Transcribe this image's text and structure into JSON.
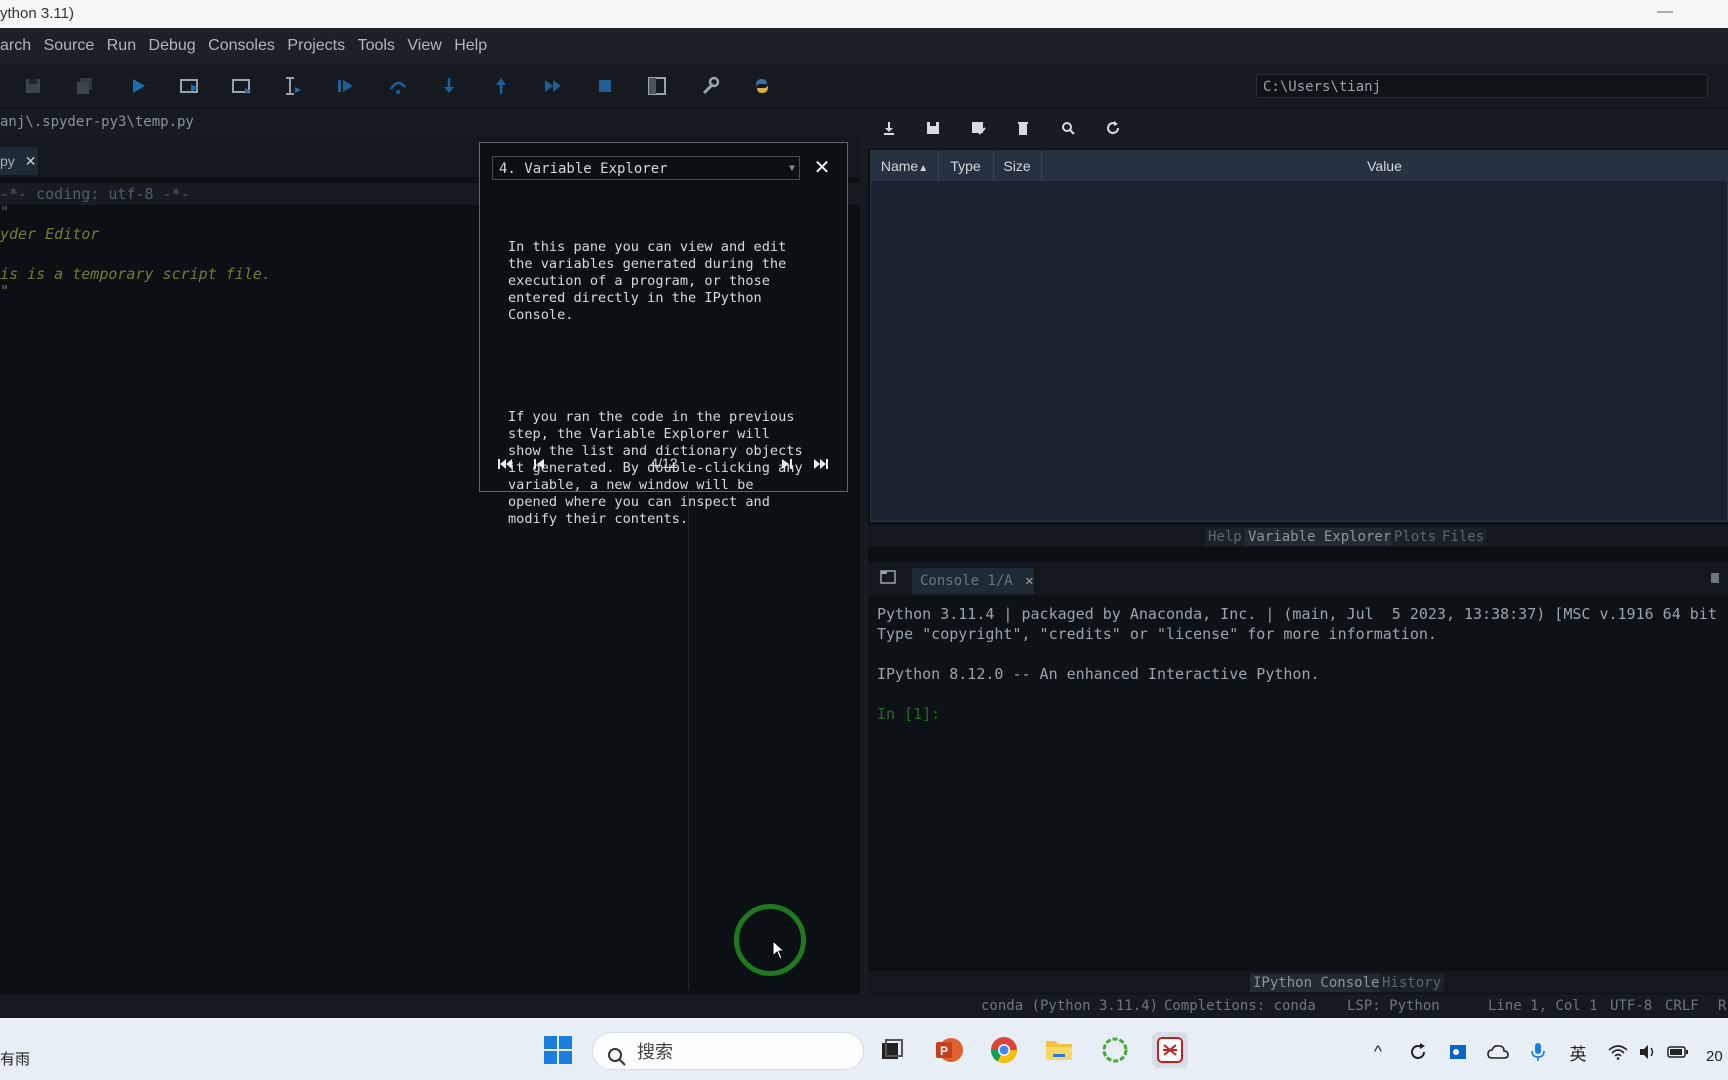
{
  "window": {
    "title": "ython 3.11)",
    "minimize": "—"
  },
  "menu": [
    "arch",
    "Source",
    "Run",
    "Debug",
    "Consoles",
    "Projects",
    "Tools",
    "View",
    "Help"
  ],
  "toolbar": {
    "working_dir": "C:\\Users\\tianj"
  },
  "editor": {
    "path": "anj\\.spyder-py3\\temp.py",
    "tab_label": "py",
    "lines": [
      "-*- coding: utf-8 -*-",
      "\"",
      "yder Editor",
      "",
      "is is a temporary script file.",
      "\""
    ]
  },
  "tour": {
    "selected": "4. Variable Explorer",
    "paragraph1": "In this pane you can view and edit\nthe variables generated during the\nexecution of a program, or those\nentered directly in the IPython\nConsole.",
    "paragraph2": "If you ran the code in the previous\nstep, the Variable Explorer will\nshow the list and dictionary objects\nit generated. By double-clicking any\nvariable, a new window will be\nopened where you can inspect and\nmodify their contents.",
    "step": "4/12"
  },
  "variable_explorer": {
    "columns": [
      "Name",
      "Type",
      "Size",
      "Value"
    ],
    "pane_tabs": [
      "Help",
      "Variable Explorer",
      "Plots",
      "Files"
    ],
    "active_tab": "Variable Explorer"
  },
  "console": {
    "tab_label": "Console 1/A",
    "lines": [
      "Python 3.11.4 | packaged by Anaconda, Inc. | (main, Jul  5 2023, 13:38:37) [MSC v.1916 64 bit (",
      "Type \"copyright\", \"credits\" or \"license\" for more information.",
      "",
      "IPython 8.12.0 -- An enhanced Interactive Python.",
      "",
      "In [1]:"
    ],
    "pane_tabs": [
      "IPython Console",
      "History"
    ],
    "active_tab": "IPython Console"
  },
  "status": {
    "env": "conda (Python 3.11.4)",
    "completions": "Completions: conda",
    "lsp": "LSP: Python",
    "position": "Line 1, Col 1",
    "encoding": "UTF-8",
    "eol": "CRLF",
    "rw": "R"
  },
  "taskbar": {
    "weather": "有雨",
    "search_placeholder": "搜索",
    "ime": "英",
    "clock": "20"
  },
  "colors": {
    "accent": "#1f7a1f",
    "tour_border": "#5f6870"
  }
}
